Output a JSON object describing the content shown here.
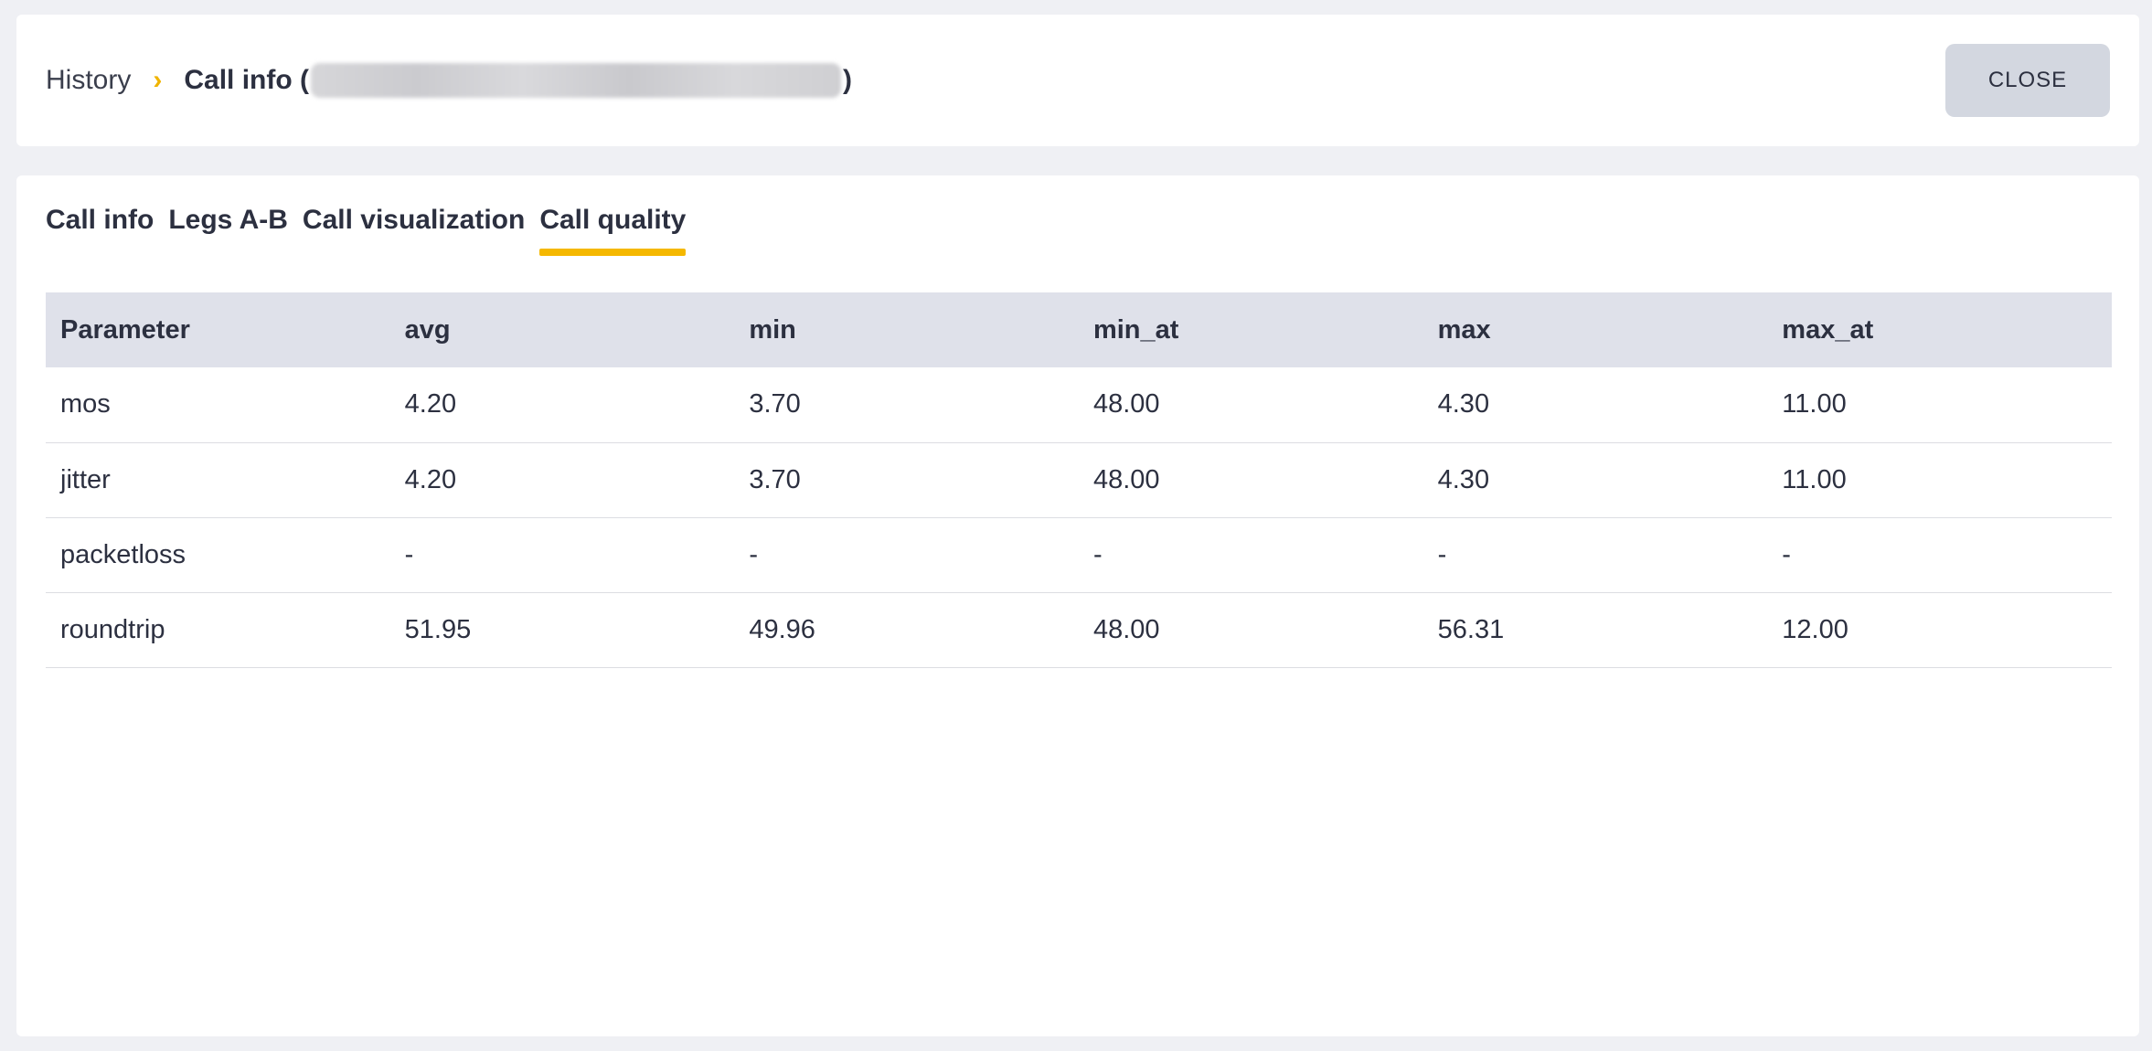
{
  "breadcrumb": {
    "history": "History",
    "separator": "›",
    "current": "Call info (",
    "close_paren": ")"
  },
  "header": {
    "close_label": "CLOSE"
  },
  "tabs": [
    {
      "label": "Call info",
      "active": false
    },
    {
      "label": "Legs A-B",
      "active": false
    },
    {
      "label": "Call visualization",
      "active": false
    },
    {
      "label": "Call quality",
      "active": true
    }
  ],
  "table": {
    "columns": [
      "Parameter",
      "avg",
      "min",
      "min_at",
      "max",
      "max_at"
    ],
    "rows": [
      [
        "mos",
        "4.20",
        "3.70",
        "48.00",
        "4.30",
        "11.00"
      ],
      [
        "jitter",
        "4.20",
        "3.70",
        "48.00",
        "4.30",
        "11.00"
      ],
      [
        "packetloss",
        "-",
        "-",
        "-",
        "-",
        "-"
      ],
      [
        "roundtrip",
        "51.95",
        "49.96",
        "48.00",
        "56.31",
        "12.00"
      ]
    ]
  },
  "colors": {
    "accent": "#f5b800",
    "background": "#eff0f4",
    "table_header": "#dfe1ea",
    "close_button": "#d3d7e0"
  }
}
